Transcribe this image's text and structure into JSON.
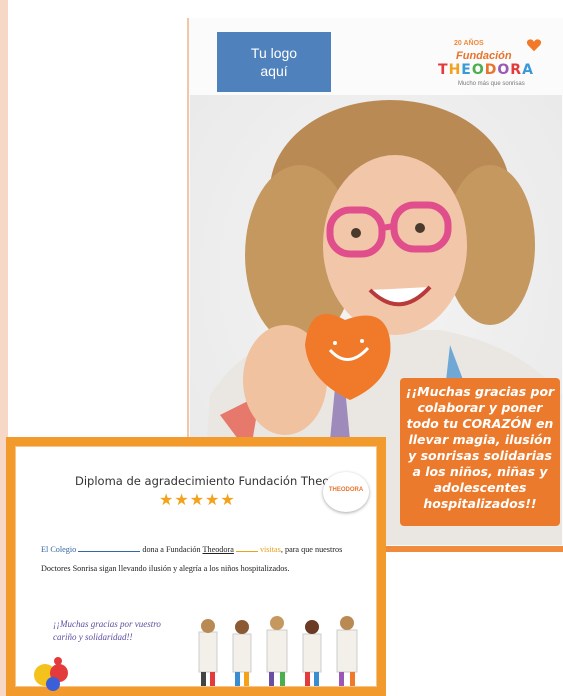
{
  "poster": {
    "logo_placeholder_line1": "Tu logo",
    "logo_placeholder_line2": "aquí",
    "brand": {
      "years": "20 AÑOS",
      "name": "Fundación",
      "wordmark": [
        "T",
        "H",
        "E",
        "O",
        "D",
        "O",
        "R",
        "A"
      ],
      "tagline": "Mucho más que sonrisas"
    },
    "thanks_message": "¡¡Muchas gracias por colaborar y  poner todo tu CORAZÓN en llevar magia, ilusión y sonrisas solidarias a los niños, niñas y adolescentes hospitalizados!!"
  },
  "diploma": {
    "title": "Diploma de agradecimiento Fundación Theodora",
    "stars": "★★★★★",
    "logo_text": "THEODORA",
    "body_part1": "El Colegio",
    "body_part2": "dona a Fundación",
    "body_part3": "Theodora",
    "body_part4": "visitas",
    "body_part5": ", para que nuestros Doctores Sonrisa sigan llevando ilusión y alegría a los niños hospitalizados.",
    "thanks": "¡¡Muchas gracias por vuestro cariño y  solidaridad!!"
  },
  "colors": {
    "accent_orange": "#ec7a2c",
    "logo_blue": "#4f81bd",
    "diploma_border": "#f39a2d"
  }
}
